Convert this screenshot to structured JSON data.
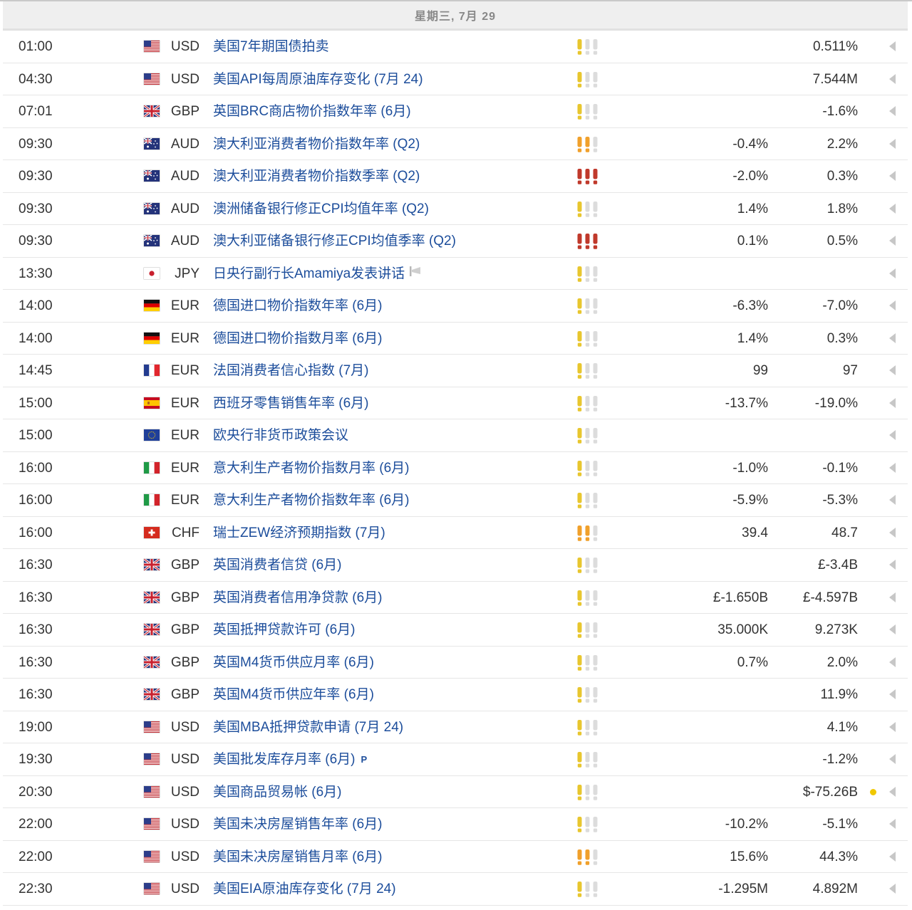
{
  "date_header": "星期三, 7月 29",
  "colors": {
    "importance_low": "#e8c62e",
    "importance_medium": "#f0a02b",
    "importance_high": "#c0392b",
    "importance_empty": "#dcdcdc",
    "event_link": "#1c4d9b"
  },
  "events": [
    {
      "time": "01:00",
      "flag": "us-flag-icon",
      "currency": "USD",
      "event": "美国7年期国债拍卖",
      "importance": 1,
      "forecast": "",
      "previous": "0.511%"
    },
    {
      "time": "04:30",
      "flag": "us-flag-icon",
      "currency": "USD",
      "event": "美国API每周原油库存变化 (7月 24)",
      "importance": 1,
      "forecast": "",
      "previous": "7.544M"
    },
    {
      "time": "07:01",
      "flag": "gb-flag-icon",
      "currency": "GBP",
      "event": "英国BRC商店物价指数年率 (6月)",
      "importance": 1,
      "forecast": "",
      "previous": "-1.6%"
    },
    {
      "time": "09:30",
      "flag": "au-flag-icon",
      "currency": "AUD",
      "event": "澳大利亚消费者物价指数年率 (Q2)",
      "importance": 2,
      "forecast": "-0.4%",
      "previous": "2.2%"
    },
    {
      "time": "09:30",
      "flag": "au-flag-icon",
      "currency": "AUD",
      "event": "澳大利亚消费者物价指数季率 (Q2)",
      "importance": 3,
      "forecast": "-2.0%",
      "previous": "0.3%"
    },
    {
      "time": "09:30",
      "flag": "au-flag-icon",
      "currency": "AUD",
      "event": "澳洲储备银行修正CPI均值年率 (Q2)",
      "importance": 1,
      "forecast": "1.4%",
      "previous": "1.8%"
    },
    {
      "time": "09:30",
      "flag": "au-flag-icon",
      "currency": "AUD",
      "event": "澳大利亚储备银行修正CPI均值季率 (Q2)",
      "importance": 3,
      "forecast": "0.1%",
      "previous": "0.5%"
    },
    {
      "time": "13:30",
      "flag": "jp-flag-icon",
      "currency": "JPY",
      "event": "日央行副行长Amamiya发表讲话",
      "importance": 1,
      "forecast": "",
      "previous": "",
      "speech": true
    },
    {
      "time": "14:00",
      "flag": "de-flag-icon",
      "currency": "EUR",
      "event": "德国进口物价指数年率 (6月)",
      "importance": 1,
      "forecast": "-6.3%",
      "previous": "-7.0%"
    },
    {
      "time": "14:00",
      "flag": "de-flag-icon",
      "currency": "EUR",
      "event": "德国进口物价指数月率 (6月)",
      "importance": 1,
      "forecast": "1.4%",
      "previous": "0.3%"
    },
    {
      "time": "14:45",
      "flag": "fr-flag-icon",
      "currency": "EUR",
      "event": "法国消费者信心指数 (7月)",
      "importance": 1,
      "forecast": "99",
      "previous": "97"
    },
    {
      "time": "15:00",
      "flag": "es-flag-icon",
      "currency": "EUR",
      "event": "西班牙零售销售年率 (6月)",
      "importance": 1,
      "forecast": "-13.7%",
      "previous": "-19.0%"
    },
    {
      "time": "15:00",
      "flag": "eu-flag-icon",
      "currency": "EUR",
      "event": "欧央行非货币政策会议",
      "importance": 1,
      "forecast": "",
      "previous": ""
    },
    {
      "time": "16:00",
      "flag": "it-flag-icon",
      "currency": "EUR",
      "event": "意大利生产者物价指数月率 (6月)",
      "importance": 1,
      "forecast": "-1.0%",
      "previous": "-0.1%"
    },
    {
      "time": "16:00",
      "flag": "it-flag-icon",
      "currency": "EUR",
      "event": "意大利生产者物价指数年率 (6月)",
      "importance": 1,
      "forecast": "-5.9%",
      "previous": "-5.3%"
    },
    {
      "time": "16:00",
      "flag": "ch-flag-icon",
      "currency": "CHF",
      "event": "瑞士ZEW经济预期指数 (7月)",
      "importance": 2,
      "forecast": "39.4",
      "previous": "48.7"
    },
    {
      "time": "16:30",
      "flag": "gb-flag-icon",
      "currency": "GBP",
      "event": "英国消费者信贷 (6月)",
      "importance": 1,
      "forecast": "",
      "previous": "£-3.4B"
    },
    {
      "time": "16:30",
      "flag": "gb-flag-icon",
      "currency": "GBP",
      "event": "英国消费者信用净贷款 (6月)",
      "importance": 1,
      "forecast": "£-1.650B",
      "previous": "£-4.597B"
    },
    {
      "time": "16:30",
      "flag": "gb-flag-icon",
      "currency": "GBP",
      "event": "英国抵押贷款许可 (6月)",
      "importance": 1,
      "forecast": "35.000K",
      "previous": "9.273K"
    },
    {
      "time": "16:30",
      "flag": "gb-flag-icon",
      "currency": "GBP",
      "event": "英国M4货币供应月率 (6月)",
      "importance": 1,
      "forecast": "0.7%",
      "previous": "2.0%"
    },
    {
      "time": "16:30",
      "flag": "gb-flag-icon",
      "currency": "GBP",
      "event": "英国M4货币供应年率 (6月)",
      "importance": 1,
      "forecast": "",
      "previous": "11.9%"
    },
    {
      "time": "19:00",
      "flag": "us-flag-icon",
      "currency": "USD",
      "event": "美国MBA抵押贷款申请 (7月 24)",
      "importance": 1,
      "forecast": "",
      "previous": "4.1%"
    },
    {
      "time": "19:30",
      "flag": "us-flag-icon",
      "currency": "USD",
      "event": "美国批发库存月率 (6月)",
      "importance": 1,
      "forecast": "",
      "previous": "-1.2%",
      "preliminary": "P"
    },
    {
      "time": "20:30",
      "flag": "us-flag-icon",
      "currency": "USD",
      "event": "美国商品贸易帐 (6月)",
      "importance": 1,
      "forecast": "",
      "previous": "$-75.26B",
      "revised_dot": true
    },
    {
      "time": "22:00",
      "flag": "us-flag-icon",
      "currency": "USD",
      "event": "美国未决房屋销售年率 (6月)",
      "importance": 1,
      "forecast": "-10.2%",
      "previous": "-5.1%"
    },
    {
      "time": "22:00",
      "flag": "us-flag-icon",
      "currency": "USD",
      "event": "美国未决房屋销售月率 (6月)",
      "importance": 2,
      "forecast": "15.6%",
      "previous": "44.3%"
    },
    {
      "time": "22:30",
      "flag": "us-flag-icon",
      "currency": "USD",
      "event": "美国EIA原油库存变化 (7月 24)",
      "importance": 1,
      "forecast": "-1.295M",
      "previous": "4.892M"
    }
  ]
}
